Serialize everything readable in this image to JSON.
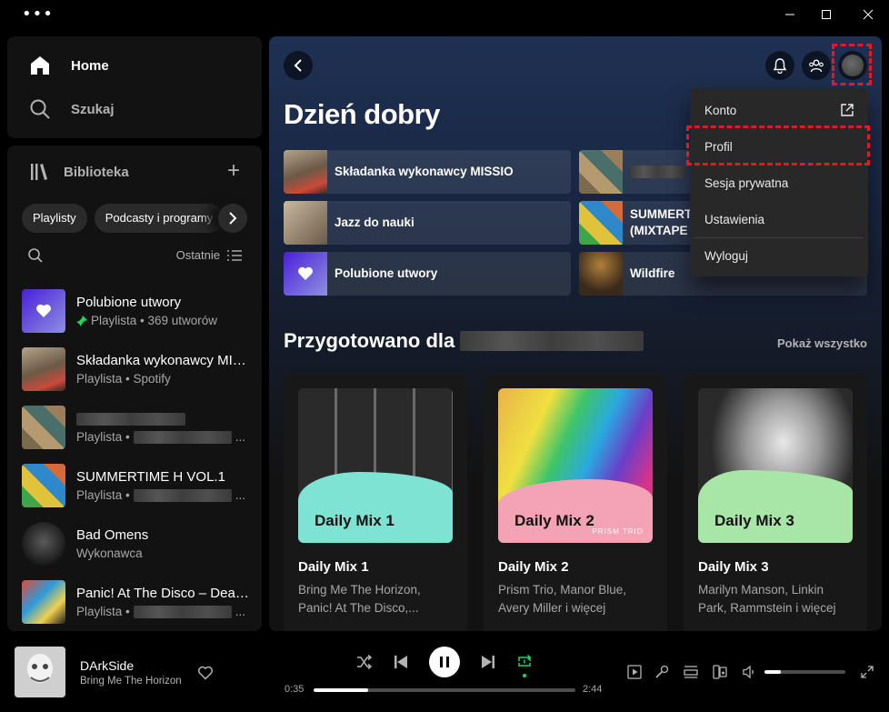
{
  "window": {
    "menu_dots": "•••"
  },
  "nav": {
    "home": "Home",
    "search": "Szukaj"
  },
  "library": {
    "title": "Biblioteka",
    "add": "+",
    "chips": [
      "Playlisty",
      "Podcasty i programy"
    ],
    "sort": "Ostatnie",
    "items": [
      {
        "title": "Polubione utwory",
        "sub": "Playlista • 369 utworów",
        "pinned": true
      },
      {
        "title": "Składanka wykonawcy MISSIO",
        "sub": "Playlista • Spotify"
      },
      {
        "title": "",
        "sub": "Playlista •",
        "redacted": true
      },
      {
        "title": "SUMMERTIME H VOL.1",
        "sub": "Playlista •",
        "redacted_sub": true
      },
      {
        "title": "Bad Omens",
        "sub": "Wykonawca"
      },
      {
        "title": "Panic! At The Disco – Death of a Bachelor",
        "sub": "Playlista •",
        "redacted_sub": true
      }
    ]
  },
  "main": {
    "greeting": "Dzień dobry",
    "shortcuts": [
      {
        "label": "Składanka wykonawcy MISSIO"
      },
      {
        "label": ""
      },
      {
        "label": "Jazz do nauki"
      },
      {
        "label": "SUMMERTIME (MIXTAPE"
      },
      {
        "label": "Polubione utwory"
      },
      {
        "label": "Wildfire"
      }
    ],
    "section_title": "Przygotowano dla",
    "show_all": "Pokaż wszystko",
    "cards": [
      {
        "cover_label": "Daily Mix 1",
        "title": "Daily Mix 1",
        "desc": "Bring Me The Horizon, Panic! At The Disco,..."
      },
      {
        "cover_label": "Daily Mix 2",
        "title": "Daily Mix 2",
        "desc": "Prism Trio, Manor Blue, Avery Miller i więcej"
      },
      {
        "cover_label": "Daily Mix 3",
        "title": "Daily Mix 3",
        "desc": "Marilyn Manson, Linkin Park, Rammstein i więcej"
      }
    ],
    "cover_small_text": {
      "mix2": "PRISM TRIO"
    }
  },
  "profile_menu": {
    "items": [
      "Konto",
      "Profil",
      "Sesja prywatna",
      "Ustawienia",
      "Wyloguj"
    ]
  },
  "player": {
    "track_title": "DArkSide",
    "track_artist": "Bring Me The Horizon",
    "elapsed": "0:35",
    "duration": "2:44",
    "progress": 0.21,
    "volume": 0.2
  },
  "colors": {
    "accent_green": "#1ed760",
    "highlight_red": "#e01b24",
    "liked_purple": "#5038a0"
  }
}
